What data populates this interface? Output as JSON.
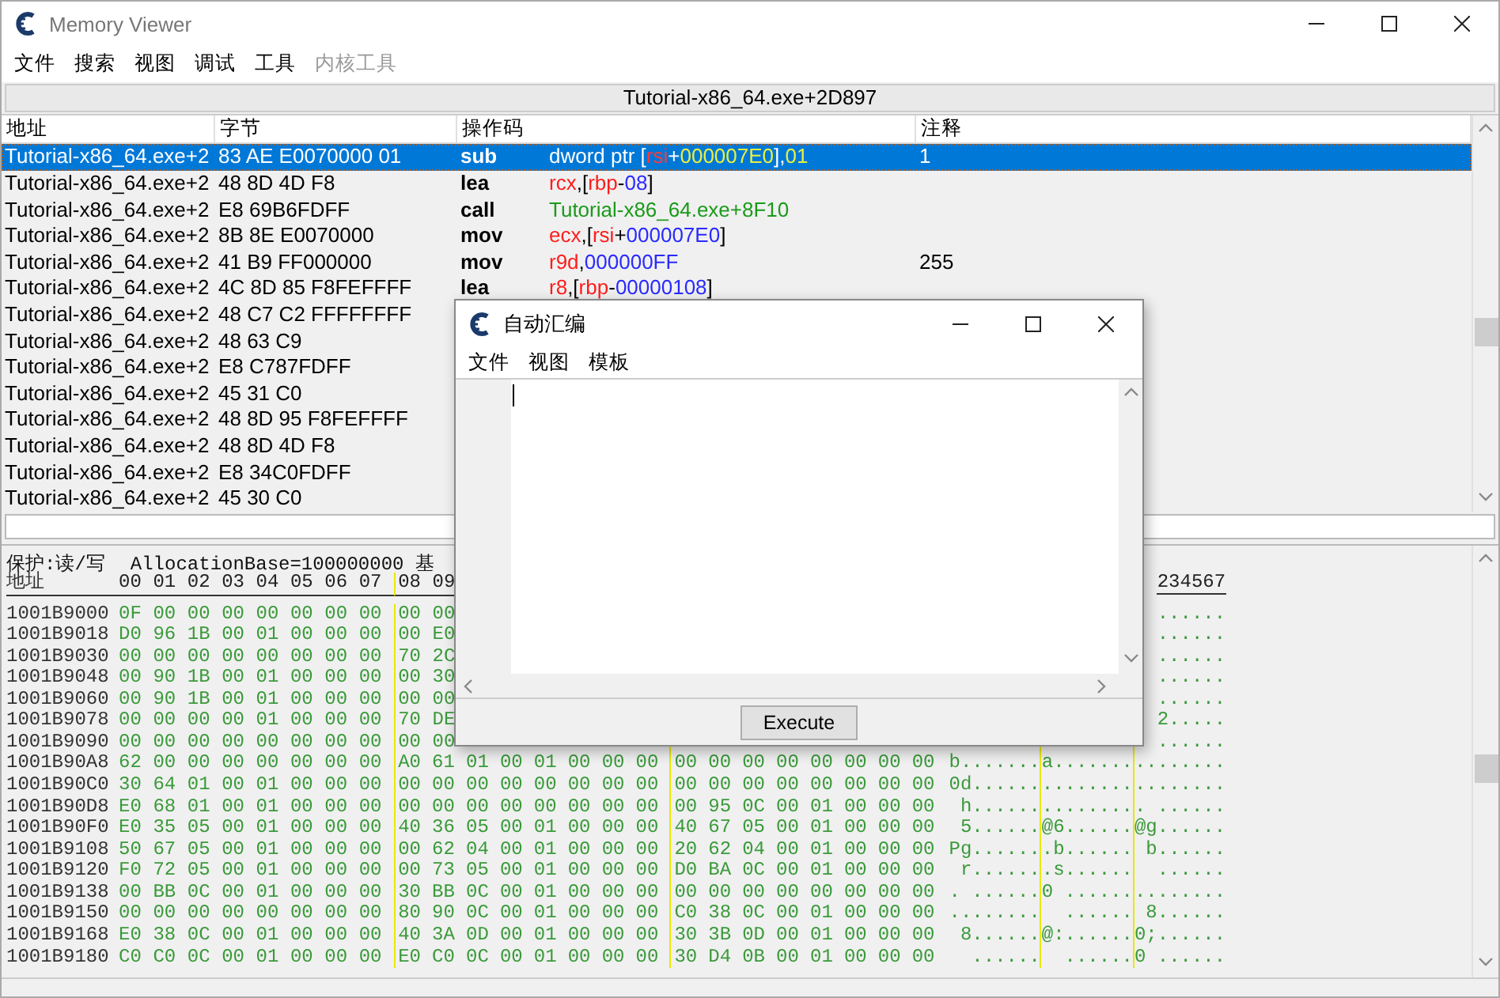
{
  "window": {
    "title": "Memory Viewer"
  },
  "menu": [
    {
      "label": "文件",
      "disabled": false
    },
    {
      "label": "搜索",
      "disabled": false
    },
    {
      "label": "视图",
      "disabled": false
    },
    {
      "label": "调试",
      "disabled": false
    },
    {
      "label": "工具",
      "disabled": false
    },
    {
      "label": "内核工具",
      "disabled": true
    }
  ],
  "address_bar": "Tutorial-x86_64.exe+2D897",
  "disassembly": {
    "columns": [
      "地址",
      "字节",
      "操作码",
      "注释"
    ],
    "rows": [
      {
        "address": "Tutorial-x86_64.exe+2",
        "bytes": "83 AE E0070000 01",
        "opcode": "sub",
        "operands": [
          {
            "kind": "plain",
            "text": "dword ptr ["
          },
          {
            "kind": "reg",
            "text": "rsi"
          },
          {
            "kind": "plain",
            "text": "+"
          },
          {
            "kind": "num",
            "text": "000007E0"
          },
          {
            "kind": "plain",
            "text": "],"
          },
          {
            "kind": "num",
            "text": "01"
          }
        ],
        "comment": "1",
        "selected": true
      },
      {
        "address": "Tutorial-x86_64.exe+2",
        "bytes": "48 8D 4D F8",
        "opcode": "lea",
        "operands": [
          {
            "kind": "reg",
            "text": "rcx"
          },
          {
            "kind": "plain",
            "text": ",["
          },
          {
            "kind": "reg",
            "text": "rbp"
          },
          {
            "kind": "plain",
            "text": "-"
          },
          {
            "kind": "num",
            "text": "08"
          },
          {
            "kind": "plain",
            "text": "]"
          }
        ],
        "selected": false
      },
      {
        "address": "Tutorial-x86_64.exe+2",
        "bytes": "E8 69B6FDFF",
        "opcode": "call",
        "operands": [
          {
            "kind": "sym",
            "text": "Tutorial-x86_64.exe+8F10"
          }
        ],
        "selected": false
      },
      {
        "address": "Tutorial-x86_64.exe+2",
        "bytes": "8B 8E E0070000",
        "opcode": "mov",
        "operands": [
          {
            "kind": "reg",
            "text": "ecx"
          },
          {
            "kind": "plain",
            "text": ",["
          },
          {
            "kind": "reg",
            "text": "rsi"
          },
          {
            "kind": "plain",
            "text": "+"
          },
          {
            "kind": "num",
            "text": "000007E0"
          },
          {
            "kind": "plain",
            "text": "]"
          }
        ],
        "selected": false
      },
      {
        "address": "Tutorial-x86_64.exe+2",
        "bytes": "41 B9 FF000000",
        "opcode": "mov",
        "operands": [
          {
            "kind": "reg",
            "text": "r9d"
          },
          {
            "kind": "plain",
            "text": ","
          },
          {
            "kind": "num",
            "text": "000000FF"
          }
        ],
        "comment": "255",
        "selected": false
      },
      {
        "address": "Tutorial-x86_64.exe+2",
        "bytes": "4C 8D 85 F8FEFFFF",
        "opcode": "lea",
        "operands": [
          {
            "kind": "reg",
            "text": "r8"
          },
          {
            "kind": "plain",
            "text": ",["
          },
          {
            "kind": "reg",
            "text": "rbp"
          },
          {
            "kind": "plain",
            "text": "-"
          },
          {
            "kind": "num",
            "text": "00000108"
          },
          {
            "kind": "plain",
            "text": "]"
          }
        ],
        "selected": false
      },
      {
        "address": "Tutorial-x86_64.exe+2",
        "bytes": "48 C7 C2 FFFFFFFF",
        "selected": false
      },
      {
        "address": "Tutorial-x86_64.exe+2",
        "bytes": "48 63 C9",
        "selected": false
      },
      {
        "address": "Tutorial-x86_64.exe+2",
        "bytes": "E8 C787FDFF",
        "selected": false
      },
      {
        "address": "Tutorial-x86_64.exe+2",
        "bytes": "45 31 C0",
        "selected": false
      },
      {
        "address": "Tutorial-x86_64.exe+2",
        "bytes": "48 8D 95 F8FEFFFF",
        "selected": false
      },
      {
        "address": "Tutorial-x86_64.exe+2",
        "bytes": "48 8D 4D F8",
        "selected": false
      },
      {
        "address": "Tutorial-x86_64.exe+2",
        "bytes": "E8 34C0FDFF",
        "selected": false
      },
      {
        "address": "Tutorial-x86_64.exe+2",
        "bytes": "45 30 C0",
        "selected": false
      }
    ]
  },
  "hex": {
    "protection": "保护:读/写",
    "allocation": "AllocationBase=100000000 基",
    "address_header": "地址",
    "byte_headers": [
      "00",
      "01",
      "02",
      "03",
      "04",
      "05",
      "06",
      "07",
      "08",
      "09"
    ],
    "ascii_header": "234567",
    "rows": [
      {
        "address": "1001B9000",
        "bytes": [
          "0F",
          "00",
          "00",
          "00",
          "00",
          "00",
          "00",
          "00",
          "00",
          "00"
        ],
        "ascii_tail": "......"
      },
      {
        "address": "1001B9018",
        "bytes": [
          "D0",
          "96",
          "1B",
          "00",
          "01",
          "00",
          "00",
          "00",
          "00",
          "E0"
        ],
        "ascii_tail": "......"
      },
      {
        "address": "1001B9030",
        "bytes": [
          "00",
          "00",
          "00",
          "00",
          "00",
          "00",
          "00",
          "00",
          "70",
          "2C"
        ],
        "ascii_tail": "......"
      },
      {
        "address": "1001B9048",
        "bytes": [
          "00",
          "90",
          "1B",
          "00",
          "01",
          "00",
          "00",
          "00",
          "00",
          "30"
        ],
        "ascii_tail": "......"
      },
      {
        "address": "1001B9060",
        "bytes": [
          "00",
          "90",
          "1B",
          "00",
          "01",
          "00",
          "00",
          "00",
          "00",
          "00"
        ],
        "ascii_tail": "......"
      },
      {
        "address": "1001B9078",
        "bytes": [
          "00",
          "00",
          "00",
          "00",
          "01",
          "00",
          "00",
          "00",
          "70",
          "DE"
        ],
        "ascii_tail": "2....."
      },
      {
        "address": "1001B9090",
        "bytes": [
          "00",
          "00",
          "00",
          "00",
          "00",
          "00",
          "00",
          "00",
          "00",
          "00"
        ],
        "ascii_tail": "......"
      },
      {
        "address": "1001B90A8",
        "bytes": [
          "62",
          "00",
          "00",
          "00",
          "00",
          "00",
          "00",
          "00",
          "A0",
          "61",
          "01",
          "00",
          "01",
          "00",
          "00",
          "00",
          "00",
          "00",
          "00",
          "00",
          "00",
          "00",
          "00",
          "00"
        ],
        "ascii": [
          "b.......",
          "a.......",
          "........"
        ]
      },
      {
        "address": "1001B90C0",
        "bytes": [
          "30",
          "64",
          "01",
          "00",
          "01",
          "00",
          "00",
          "00",
          "00",
          "00",
          "00",
          "00",
          "00",
          "00",
          "00",
          "00",
          "00",
          "00",
          "00",
          "00",
          "00",
          "00",
          "00",
          "00"
        ],
        "ascii": [
          "0d......",
          "........",
          "........"
        ]
      },
      {
        "address": "1001B90D8",
        "bytes": [
          "E0",
          "68",
          "01",
          "00",
          "01",
          "00",
          "00",
          "00",
          "00",
          "00",
          "00",
          "00",
          "00",
          "00",
          "00",
          "00",
          "00",
          "95",
          "0C",
          "00",
          "01",
          "00",
          "00",
          "00"
        ],
        "ascii": [
          " h......",
          "........",
          ". ......"
        ]
      },
      {
        "address": "1001B90F0",
        "bytes": [
          "E0",
          "35",
          "05",
          "00",
          "01",
          "00",
          "00",
          "00",
          "40",
          "36",
          "05",
          "00",
          "01",
          "00",
          "00",
          "00",
          "40",
          "67",
          "05",
          "00",
          "01",
          "00",
          "00",
          "00"
        ],
        "ascii": [
          " 5......",
          "@6......",
          "@g......"
        ]
      },
      {
        "address": "1001B9108",
        "bytes": [
          "50",
          "67",
          "05",
          "00",
          "01",
          "00",
          "00",
          "00",
          "00",
          "62",
          "04",
          "00",
          "01",
          "00",
          "00",
          "00",
          "20",
          "62",
          "04",
          "00",
          "01",
          "00",
          "00",
          "00"
        ],
        "ascii": [
          "Pg......",
          ".b......",
          " b......"
        ]
      },
      {
        "address": "1001B9120",
        "bytes": [
          "F0",
          "72",
          "05",
          "00",
          "01",
          "00",
          "00",
          "00",
          "00",
          "73",
          "05",
          "00",
          "01",
          "00",
          "00",
          "00",
          "D0",
          "BA",
          "0C",
          "00",
          "01",
          "00",
          "00",
          "00"
        ],
        "ascii": [
          " r......",
          ".s......",
          "  ......"
        ]
      },
      {
        "address": "1001B9138",
        "bytes": [
          "00",
          "BB",
          "0C",
          "00",
          "01",
          "00",
          "00",
          "00",
          "30",
          "BB",
          "0C",
          "00",
          "01",
          "00",
          "00",
          "00",
          "00",
          "00",
          "00",
          "00",
          "00",
          "00",
          "00",
          "00"
        ],
        "ascii": [
          ". ......",
          "0 ......",
          "........"
        ]
      },
      {
        "address": "1001B9150",
        "bytes": [
          "00",
          "00",
          "00",
          "00",
          "00",
          "00",
          "00",
          "00",
          "80",
          "90",
          "0C",
          "00",
          "01",
          "00",
          "00",
          "00",
          "C0",
          "38",
          "0C",
          "00",
          "01",
          "00",
          "00",
          "00"
        ],
        "ascii": [
          "........",
          "  ......",
          " 8......"
        ]
      },
      {
        "address": "1001B9168",
        "bytes": [
          "E0",
          "38",
          "0C",
          "00",
          "01",
          "00",
          "00",
          "00",
          "40",
          "3A",
          "0D",
          "00",
          "01",
          "00",
          "00",
          "00",
          "30",
          "3B",
          "0D",
          "00",
          "01",
          "00",
          "00",
          "00"
        ],
        "ascii": [
          " 8......",
          "@:......",
          "0;......"
        ]
      },
      {
        "address": "1001B9180",
        "bytes": [
          "C0",
          "C0",
          "0C",
          "00",
          "01",
          "00",
          "00",
          "00",
          "E0",
          "C0",
          "0C",
          "00",
          "01",
          "00",
          "00",
          "00",
          "30",
          "D4",
          "0B",
          "00",
          "01",
          "00",
          "00",
          "00"
        ],
        "ascii": [
          "  ......",
          "  ......",
          "0 ......"
        ]
      }
    ]
  },
  "dialog": {
    "title": "自动汇编",
    "menu": [
      "文件",
      "视图",
      "模板"
    ],
    "button": "Execute"
  }
}
